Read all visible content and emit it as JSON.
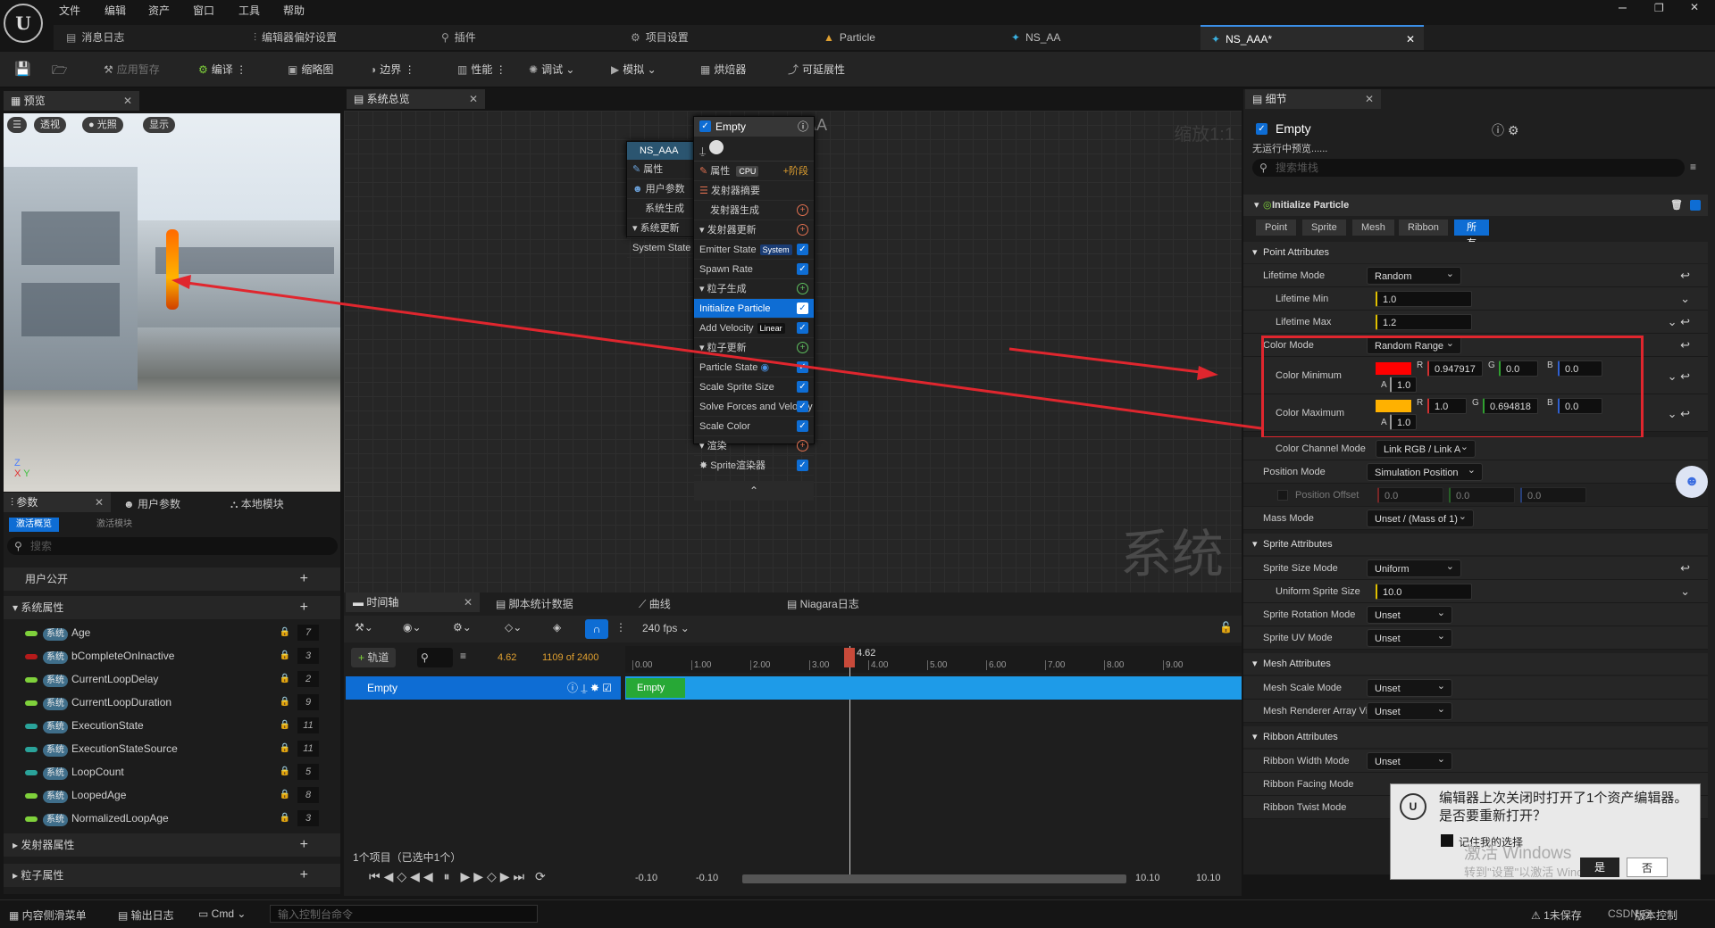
{
  "menu": [
    "文件",
    "编辑",
    "资产",
    "窗口",
    "工具",
    "帮助"
  ],
  "tabs": [
    {
      "label": "消息日志",
      "icon": "📋"
    },
    {
      "label": "编辑器偏好设置",
      "icon": "⫶"
    },
    {
      "label": "插件",
      "icon": "🔌"
    },
    {
      "label": "项目设置",
      "icon": "⚙"
    },
    {
      "label": "Particle",
      "icon": "▲"
    },
    {
      "label": "NS_AA",
      "icon": "✦"
    },
    {
      "label": "NS_AAA*",
      "icon": "✦"
    }
  ],
  "toolbar": {
    "apply": "应用暂存",
    "compile": "编译",
    "thumbnail": "缩略图",
    "bounds": "边界",
    "perf": "性能",
    "debug": "调试",
    "simulate": "模拟",
    "baker": "烘焙器",
    "scalability": "可延展性"
  },
  "preview": {
    "title": "预览",
    "perspective": "透视",
    "lit": "光照",
    "show": "显示"
  },
  "overview": {
    "title": "系统总览",
    "graph_title": "NS_AAA",
    "zoom": "缩放1:1",
    "watermark": "系统"
  },
  "sys_node": {
    "title": "NS_AAA",
    "rows": [
      "属性",
      "用户参数",
      "系统生成",
      "系统更新",
      "System State"
    ]
  },
  "emitter": {
    "title": "Empty",
    "props": "属性",
    "cpu": "CPU",
    "stage": "阶段",
    "summary": "发射器摘要",
    "spawn": "发射器生成",
    "update": "发射器更新",
    "emitter_state": "Emitter State",
    "system_tag": "System",
    "spawn_rate": "Spawn Rate",
    "particle_spawn": "粒子生成",
    "init_particle": "Initialize Particle",
    "add_velocity": "Add Velocity",
    "linear_tag": "Linear",
    "particle_update": "粒子更新",
    "particle_state": "Particle State",
    "scale_sprite": "Scale Sprite Size",
    "solve_forces": "Solve Forces and Velocity",
    "scale_color": "Scale Color",
    "render": "渲染",
    "sprite_renderer": "Sprite渲染器"
  },
  "details": {
    "title": "细节",
    "emitter": "Empty",
    "no_preview": "无运行中预览......",
    "search": "搜索堆栈",
    "module": "Initialize Particle",
    "filters": [
      "Point",
      "Sprite",
      "Mesh",
      "Ribbon",
      "所有"
    ],
    "point_attr": "Point Attributes",
    "lifetime_mode": "Lifetime Mode",
    "lifetime_mode_val": "Random",
    "lifetime_min": "Lifetime Min",
    "lifetime_min_val": "1.0",
    "lifetime_max": "Lifetime Max",
    "lifetime_max_val": "1.2",
    "color_mode": "Color Mode",
    "color_mode_val": "Random Range",
    "color_min": "Color Minimum",
    "cmin_r": "0.947917",
    "cmin_g": "0.0",
    "cmin_b": "0.0",
    "cmin_a": "1.0",
    "color_max": "Color Maximum",
    "cmax_r": "1.0",
    "cmax_g": "0.694818",
    "cmax_b": "0.0",
    "cmax_a": "1.0",
    "channel_mode": "Color Channel Mode",
    "channel_mode_val": "Link RGB / Link A",
    "position_mode": "Position Mode",
    "position_mode_val": "Simulation Position",
    "position_offset": "Position Offset",
    "po_x": "0.0",
    "po_y": "0.0",
    "po_z": "0.0",
    "mass_mode": "Mass Mode",
    "mass_mode_val": "Unset / (Mass of 1)",
    "sprite_attr": "Sprite Attributes",
    "sprite_size_mode": "Sprite Size Mode",
    "sprite_size_mode_val": "Uniform",
    "uniform_size": "Uniform Sprite Size",
    "uniform_size_val": "10.0",
    "sprite_rot": "Sprite Rotation Mode",
    "sprite_rot_val": "Unset",
    "sprite_uv": "Sprite UV Mode",
    "sprite_uv_val": "Unset",
    "mesh_attr": "Mesh Attributes",
    "mesh_scale": "Mesh Scale Mode",
    "mesh_scale_val": "Unset",
    "mesh_renderer": "Mesh Renderer Array Vi",
    "mesh_renderer_val": "Unset",
    "ribbon_attr": "Ribbon Attributes",
    "ribbon_width": "Ribbon Width Mode",
    "ribbon_width_val": "Unset",
    "ribbon_facing": "Ribbon Facing Mode",
    "ribbon_twist": "Ribbon Twist Mode",
    "colors": {
      "cmin": "#ff0000",
      "cmax": "#ffb100"
    }
  },
  "params": {
    "tab": "参数",
    "user_tab": "用户参数",
    "local_tab": "本地模块",
    "active": "激活概览",
    "active_mod": "激活模块",
    "search": "搜索",
    "user_public": "用户公开",
    "sys_attrs": "系统属性",
    "emitter_attrs": "发射器属性",
    "particle_attrs": "粒子属性",
    "sys_tag": "系统",
    "items": [
      {
        "name": "Age",
        "count": "7",
        "color": "#7fd13b"
      },
      {
        "name": "bCompleteOnInactive",
        "count": "3",
        "color": "#b41a1a"
      },
      {
        "name": "CurrentLoopDelay",
        "count": "2",
        "color": "#7fd13b"
      },
      {
        "name": "CurrentLoopDuration",
        "count": "9",
        "color": "#7fd13b"
      },
      {
        "name": "ExecutionState",
        "count": "11",
        "color": "#2aa39a"
      },
      {
        "name": "ExecutionStateSource",
        "count": "11",
        "color": "#2aa39a"
      },
      {
        "name": "LoopCount",
        "count": "5",
        "color": "#2aa39a"
      },
      {
        "name": "LoopedAge",
        "count": "8",
        "color": "#7fd13b"
      },
      {
        "name": "NormalizedLoopAge",
        "count": "3",
        "color": "#7fd13b"
      }
    ]
  },
  "timeline": {
    "tab": "时间轴",
    "stats": "脚本统计数据",
    "curves": "曲线",
    "log": "Niagara日志",
    "fps": "240 fps",
    "add_track": "轨道",
    "time": "4.62",
    "frames": "1109 of 2400",
    "playhead": "4.62",
    "track": "Empty",
    "track_block": "Empty",
    "items_info": "1个项目（已选中1个）",
    "range_l1": "-0.10",
    "range_l2": "-0.10",
    "range_r1": "10.10",
    "range_r2": "10.10",
    "ticks": [
      "0.00",
      "1.00",
      "2.00",
      "3.00",
      "4.00",
      "5.00",
      "6.00",
      "7.00",
      "8.00",
      "9.00"
    ]
  },
  "status": {
    "drawer": "内容侧滑菜单",
    "output": "输出日志",
    "cmd": "Cmd",
    "console": "输入控制台命令",
    "unsaved": "1未保存",
    "source": "版本控制"
  },
  "dialog": {
    "text": "编辑器上次关闭时打开了1个资产编辑器。是否要重新打开？",
    "remember": "记住我的选择",
    "yes": "是",
    "no": "否",
    "activate1": "激活 Windows",
    "activate2": "转到\"设置\"以激活 Windows。",
    "csdn": "CSDN @"
  }
}
